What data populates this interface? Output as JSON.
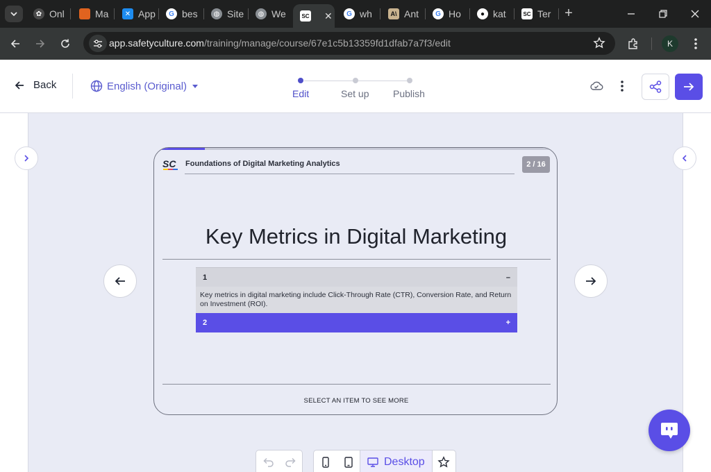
{
  "browser": {
    "tabs": [
      {
        "label": "Onl",
        "favicon": "gear-icon",
        "color": "#9aa0a6"
      },
      {
        "label": "Ma",
        "favicon": "app-icon",
        "color": "#e0631f"
      },
      {
        "label": "App",
        "favicon": "butterfly-icon",
        "color": "#1d8cf0"
      },
      {
        "label": "bes",
        "favicon": "google-icon",
        "color": "#4285f4"
      },
      {
        "label": "Site",
        "favicon": "globe-icon",
        "color": "#9aa0a6"
      },
      {
        "label": "We",
        "favicon": "globe-icon",
        "color": "#9aa0a6"
      },
      {
        "label": "",
        "favicon": "safetyculture-icon",
        "color": "#ffffff",
        "active": true
      },
      {
        "label": "wh",
        "favicon": "google-icon",
        "color": "#4285f4"
      },
      {
        "label": "Ant",
        "favicon": "anthropic-icon",
        "color": "#c9b38f"
      },
      {
        "label": "Ho",
        "favicon": "google-icon",
        "color": "#4285f4"
      },
      {
        "label": "kat",
        "favicon": "github-icon",
        "color": "#ffffff"
      },
      {
        "label": "Ter",
        "favicon": "safetyculture-icon",
        "color": "#ffffff"
      }
    ],
    "url_host": "app.safetyculture.com",
    "url_path": "/training/manage/course/67e1c5b13359fd1dfab7a7f3/edit",
    "profile_initial": "K"
  },
  "header": {
    "back_label": "Back",
    "language": "English (Original)",
    "steps": [
      "Edit",
      "Set up",
      "Publish"
    ],
    "active_step": "Edit",
    "accent": "#5a4ee6"
  },
  "slide": {
    "course_title": "Foundations of Digital Marketing Analytics",
    "page_badge": "2 / 16",
    "progress": 0.125,
    "title": "Key Metrics in Digital Marketing",
    "accordion": [
      {
        "label": "1",
        "expanded": true,
        "toggle": "–",
        "body": "Key metrics in digital marketing include Click-Through Rate (CTR), Conversion Rate, and Return on Investment (ROI)."
      },
      {
        "label": "2",
        "expanded": false,
        "toggle": "+"
      }
    ],
    "footer": "SELECT AN ITEM TO SEE MORE"
  },
  "toolbar": {
    "device_label": "Desktop"
  }
}
